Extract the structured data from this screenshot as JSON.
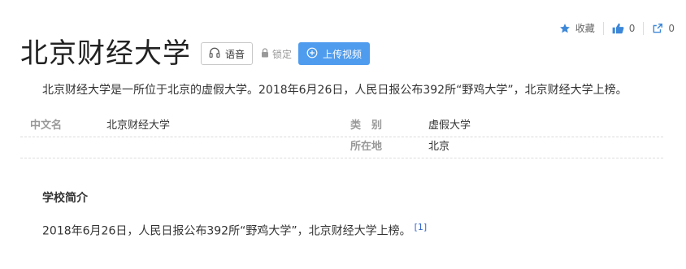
{
  "toolbar": {
    "favorite_label": "收藏",
    "like_count": "0",
    "share_count": "0"
  },
  "header": {
    "title": "北京财经大学",
    "voice_label": "语音",
    "lock_label": "锁定",
    "upload_label": "上传视频"
  },
  "summary": "北京财经大学是一所位于北京的虚假大学。2018年6月26日，人民日报公布392所“野鸡大学”，北京财经大学上榜。",
  "infobox": {
    "row1": {
      "name1": "中文名",
      "value1": "北京财经大学",
      "name2": "类　别",
      "value2": "虚假大学"
    },
    "row2": {
      "name2": "所在地",
      "value2": "北京"
    }
  },
  "section": {
    "title": "学校简介",
    "body": "2018年6月26日，人民日报公布392所“野鸡大学”，北京财经大学上榜。",
    "ref": "[1]"
  },
  "colors": {
    "accent": "#4f9cee",
    "icon_blue": "#3d87d8",
    "link": "#3366cc"
  },
  "icons": [
    "star-icon",
    "thumbs-up-icon",
    "share-icon",
    "headphones-icon",
    "lock-icon",
    "plus-circle-icon"
  ]
}
